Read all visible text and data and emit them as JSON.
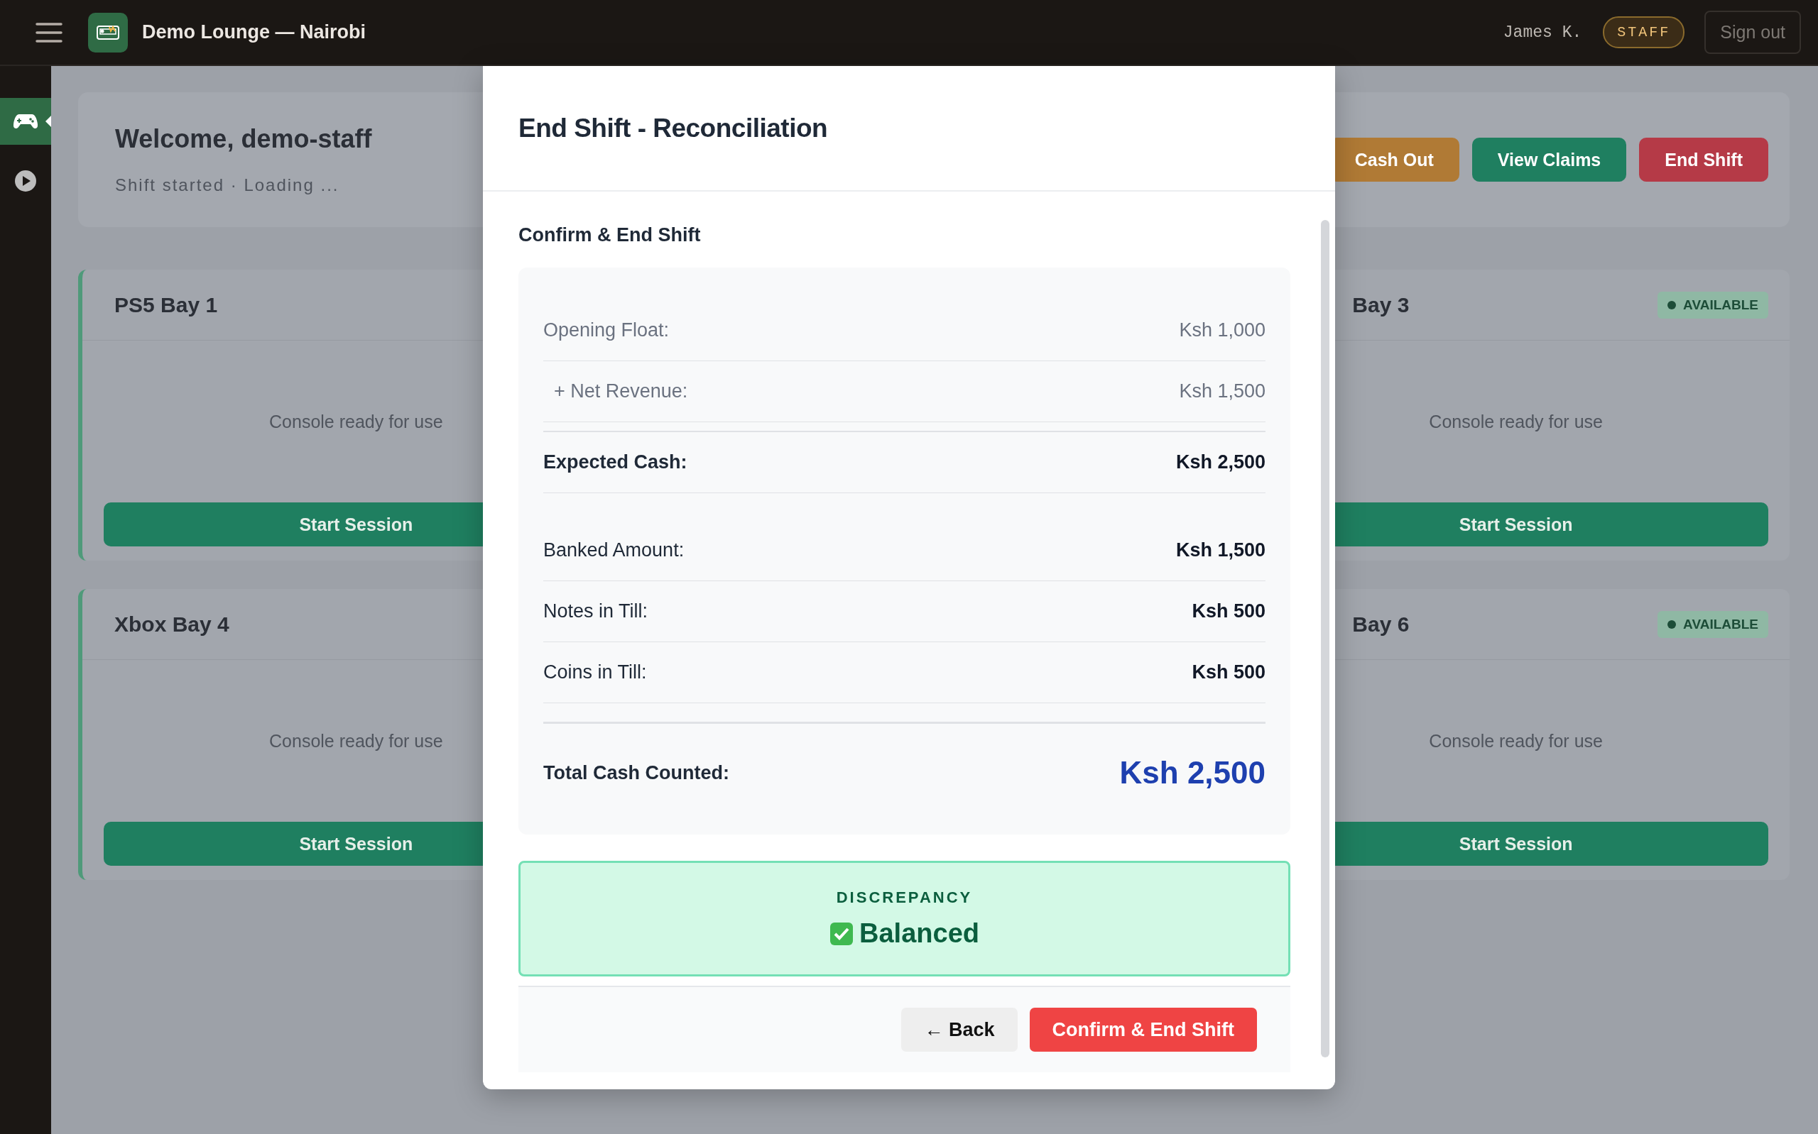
{
  "topbar": {
    "title": "Demo Lounge — Nairobi",
    "user": "James K.",
    "role_badge": "STAFF",
    "sign_out": "Sign out"
  },
  "sidebar": {
    "items": [
      {
        "kind": "gamepad",
        "selected": true
      },
      {
        "kind": "play",
        "selected": false
      }
    ]
  },
  "dashboard": {
    "welcome": "Welcome, demo-staff",
    "subtitle": "Shift started · Loading ...",
    "actions": [
      {
        "label": "Cash Out",
        "color": "#b07a35"
      },
      {
        "label": "View Claims",
        "color": "#1f7f60"
      },
      {
        "label": "End Shift",
        "color": "#b53a47"
      }
    ],
    "station_rows": [
      {
        "left": {
          "name": "PS5 Bay 1",
          "message": "Console ready for use",
          "action": "Start Session"
        },
        "right": {
          "name": "Bay 3",
          "status": "AVAILABLE",
          "message": "Console ready for use",
          "action": "Start Session"
        }
      },
      {
        "left": {
          "name": "Xbox Bay 4",
          "message": "Console ready for use",
          "action": "Start Session"
        },
        "right": {
          "name": "Bay 6",
          "status": "AVAILABLE",
          "message": "Console ready for use",
          "action": "Start Session"
        }
      }
    ]
  },
  "modal": {
    "title": "End Shift - Reconciliation",
    "step_title": "Confirm & End Shift",
    "rows": [
      {
        "kind": "muted",
        "label": "Opening Float:",
        "value": "Ksh 1,000"
      },
      {
        "kind": "indented",
        "label": "+ Net Revenue:",
        "value": "Ksh 1,500"
      },
      {
        "kind": "subtotal",
        "label": "Expected Cash:",
        "value": "Ksh 2,500"
      },
      {
        "kind": "strong",
        "label": "Banked Amount:",
        "value": "Ksh 1,500"
      },
      {
        "kind": "strong",
        "label": "Notes in Till:",
        "value": "Ksh 500"
      },
      {
        "kind": "strong",
        "label": "Coins in Till:",
        "value": "Ksh 500"
      },
      {
        "kind": "total",
        "label": "Total Cash Counted:",
        "value": "Ksh 2,500"
      }
    ],
    "discrepancy": {
      "label": "DISCREPANCY",
      "value": "Balanced",
      "balanced": true
    },
    "buttons": [
      {
        "kind": "secondary",
        "label": "← Back"
      },
      {
        "kind": "danger",
        "label": "Confirm & End Shift"
      }
    ]
  }
}
